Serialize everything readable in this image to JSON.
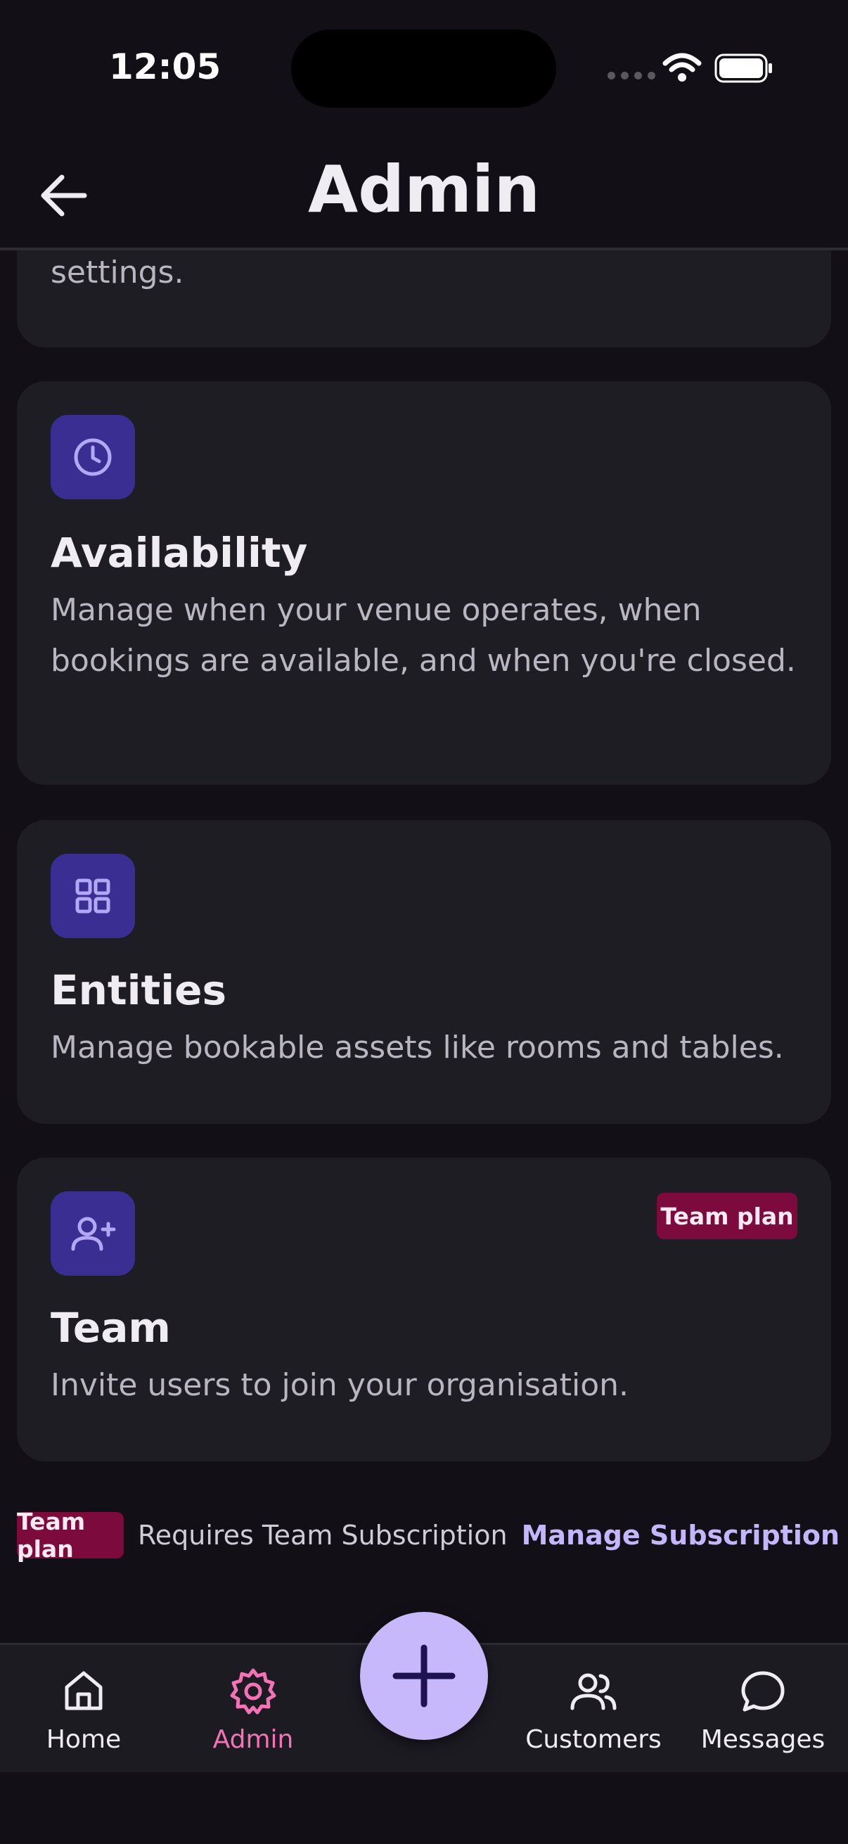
{
  "status_bar": {
    "time": "12:05"
  },
  "header": {
    "title": "Admin"
  },
  "cards": [
    {
      "description_tail": "settings."
    },
    {
      "title": "Availability",
      "description": "Manage when your venue operates, when bookings are available, and when you're closed.",
      "icon": "clock-icon"
    },
    {
      "title": "Entities",
      "description": "Manage bookable assets like rooms and tables.",
      "icon": "grid-icon"
    },
    {
      "title": "Team",
      "description": "Invite users to join your organisation.",
      "icon": "user-plus-icon",
      "badge": "Team plan"
    }
  ],
  "footer_note": {
    "badge": "Team plan",
    "text": "Requires Team Subscription",
    "link": "Manage Subscription"
  },
  "tab_bar": {
    "items": [
      {
        "label": "Home",
        "icon": "home-icon"
      },
      {
        "label": "Admin",
        "icon": "gear-icon",
        "active": true
      },
      {
        "label": "Customers",
        "icon": "users-icon"
      },
      {
        "label": "Messages",
        "icon": "chat-icon"
      }
    ],
    "fab_icon": "plus-icon"
  },
  "colors": {
    "background": "#121016",
    "card": "#1e1d23",
    "icon_tile": "#3a2e92",
    "badge": "#7c0a3c",
    "accent_link": "#c4b5fd",
    "active_tab": "#f472b6",
    "fab": "#c7b8fb"
  }
}
